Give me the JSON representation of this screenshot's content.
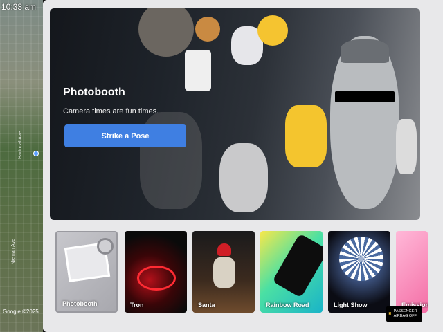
{
  "status": {
    "time": "10:33 am"
  },
  "map": {
    "streets": [
      "Hartonal Ave",
      "Nieman Ave"
    ],
    "attribution": "Google",
    "copyright": "©2025"
  },
  "hero": {
    "title": "Photobooth",
    "subtitle": "Camera times are fun times.",
    "cta_label": "Strike a Pose",
    "cta_color": "#3f7fe2"
  },
  "cards": [
    {
      "label": "Photobooth",
      "selected": true
    },
    {
      "label": "Tron",
      "selected": false
    },
    {
      "label": "Santa",
      "selected": false
    },
    {
      "label": "Rainbow Road",
      "selected": false
    },
    {
      "label": "Light Show",
      "selected": false
    },
    {
      "label": "Emission",
      "selected": false
    }
  ],
  "indicator": {
    "line1": "PASSENGER",
    "line2": "AIRBAG OFF"
  }
}
